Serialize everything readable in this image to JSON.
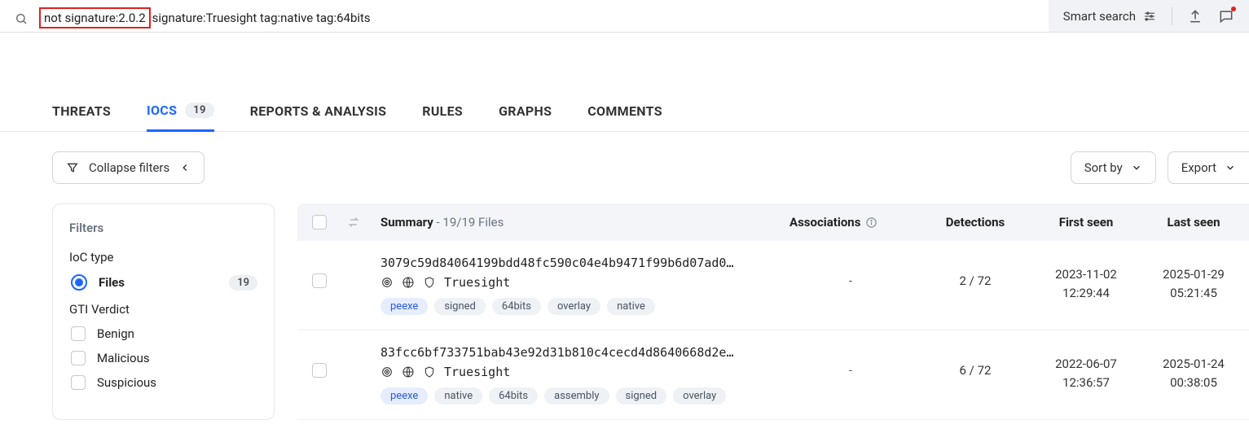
{
  "search": {
    "highlighted": "not signature:2.0.2",
    "rest": "signature:Truesight tag:native tag:64bits",
    "smart_label": "Smart search"
  },
  "tabs": {
    "threats": "THREATS",
    "iocs": "IOCS",
    "iocs_count": "19",
    "reports": "REPORTS & ANALYSIS",
    "rules": "RULES",
    "graphs": "GRAPHS",
    "comments": "COMMENTS"
  },
  "controls": {
    "collapse": "Collapse filters",
    "sort": "Sort by",
    "export": "Export"
  },
  "filters": {
    "title": "Filters",
    "ioc_type_label": "IoC type",
    "files_label": "Files",
    "files_count": "19",
    "gti_label": "GTI Verdict",
    "benign": "Benign",
    "malicious": "Malicious",
    "suspicious": "Suspicious"
  },
  "table": {
    "summary_strong": "Summary",
    "summary_rest": " - 19/19 Files",
    "assoc": "Associations",
    "detections": "Detections",
    "first": "First seen",
    "last": "Last seen"
  },
  "rows": [
    {
      "hash": "3079c59d84064199bdd48fc590c04e4b9471f99b6d07ad0…",
      "name": "Truesight",
      "assoc": "-",
      "det": "2 / 72",
      "first_date": "2023-11-02",
      "first_time": "12:29:44",
      "last_date": "2025-01-29",
      "last_time": "05:21:45",
      "tags": [
        "peexe",
        "signed",
        "64bits",
        "overlay",
        "native"
      ]
    },
    {
      "hash": "83fcc6bf733751bab43e92d31b810c4cecd4d8640668d2e…",
      "name": "Truesight",
      "assoc": "-",
      "det": "6 / 72",
      "first_date": "2022-06-07",
      "first_time": "12:36:57",
      "last_date": "2025-01-24",
      "last_time": "00:38:05",
      "tags": [
        "peexe",
        "native",
        "64bits",
        "assembly",
        "signed",
        "overlay"
      ]
    }
  ]
}
